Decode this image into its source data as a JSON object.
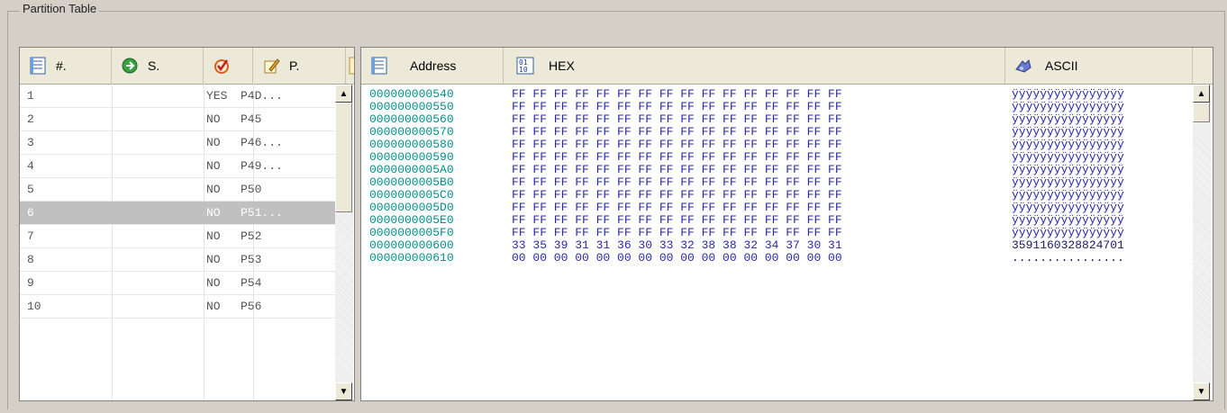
{
  "groupbox": {
    "title": "Partition Table"
  },
  "partition_table": {
    "columns": [
      {
        "label": "#.",
        "icon": "list-icon"
      },
      {
        "label": "S.",
        "icon": "green-arrow-icon"
      },
      {
        "label": "",
        "icon": "check-icon"
      },
      {
        "label": "P.",
        "icon": "pencil-icon"
      }
    ],
    "rows": [
      {
        "num": "1",
        "s": "",
        "check": "YES",
        "p": "P4D..."
      },
      {
        "num": "2",
        "s": "",
        "check": "NO",
        "p": "P45"
      },
      {
        "num": "3",
        "s": "",
        "check": "NO",
        "p": "P46..."
      },
      {
        "num": "4",
        "s": "",
        "check": "NO",
        "p": "P49..."
      },
      {
        "num": "5",
        "s": "",
        "check": "NO",
        "p": "P50"
      },
      {
        "num": "6",
        "s": "",
        "check": "NO",
        "p": "P51...",
        "selected": true
      },
      {
        "num": "7",
        "s": "",
        "check": "NO",
        "p": "P52"
      },
      {
        "num": "8",
        "s": "",
        "check": "NO",
        "p": "P53"
      },
      {
        "num": "9",
        "s": "",
        "check": "NO",
        "p": "P54"
      },
      {
        "num": "10",
        "s": "",
        "check": "NO",
        "p": "P56"
      }
    ]
  },
  "hex_view": {
    "columns": [
      {
        "label": "Address",
        "icon": "list-icon"
      },
      {
        "label": "HEX",
        "icon": "binary-icon"
      },
      {
        "label": "ASCII",
        "icon": "ascii-icon"
      }
    ],
    "rows": [
      {
        "address": "000000000540",
        "hex": "FF FF FF FF FF FF FF FF FF FF FF FF FF FF FF FF",
        "ascii": "ÿÿÿÿÿÿÿÿÿÿÿÿÿÿÿÿ"
      },
      {
        "address": "000000000550",
        "hex": "FF FF FF FF FF FF FF FF FF FF FF FF FF FF FF FF",
        "ascii": "ÿÿÿÿÿÿÿÿÿÿÿÿÿÿÿÿ"
      },
      {
        "address": "000000000560",
        "hex": "FF FF FF FF FF FF FF FF FF FF FF FF FF FF FF FF",
        "ascii": "ÿÿÿÿÿÿÿÿÿÿÿÿÿÿÿÿ"
      },
      {
        "address": "000000000570",
        "hex": "FF FF FF FF FF FF FF FF FF FF FF FF FF FF FF FF",
        "ascii": "ÿÿÿÿÿÿÿÿÿÿÿÿÿÿÿÿ"
      },
      {
        "address": "000000000580",
        "hex": "FF FF FF FF FF FF FF FF FF FF FF FF FF FF FF FF",
        "ascii": "ÿÿÿÿÿÿÿÿÿÿÿÿÿÿÿÿ"
      },
      {
        "address": "000000000590",
        "hex": "FF FF FF FF FF FF FF FF FF FF FF FF FF FF FF FF",
        "ascii": "ÿÿÿÿÿÿÿÿÿÿÿÿÿÿÿÿ"
      },
      {
        "address": "0000000005A0",
        "hex": "FF FF FF FF FF FF FF FF FF FF FF FF FF FF FF FF",
        "ascii": "ÿÿÿÿÿÿÿÿÿÿÿÿÿÿÿÿ"
      },
      {
        "address": "0000000005B0",
        "hex": "FF FF FF FF FF FF FF FF FF FF FF FF FF FF FF FF",
        "ascii": "ÿÿÿÿÿÿÿÿÿÿÿÿÿÿÿÿ"
      },
      {
        "address": "0000000005C0",
        "hex": "FF FF FF FF FF FF FF FF FF FF FF FF FF FF FF FF",
        "ascii": "ÿÿÿÿÿÿÿÿÿÿÿÿÿÿÿÿ"
      },
      {
        "address": "0000000005D0",
        "hex": "FF FF FF FF FF FF FF FF FF FF FF FF FF FF FF FF",
        "ascii": "ÿÿÿÿÿÿÿÿÿÿÿÿÿÿÿÿ"
      },
      {
        "address": "0000000005E0",
        "hex": "FF FF FF FF FF FF FF FF FF FF FF FF FF FF FF FF",
        "ascii": "ÿÿÿÿÿÿÿÿÿÿÿÿÿÿÿÿ"
      },
      {
        "address": "0000000005F0",
        "hex": "FF FF FF FF FF FF FF FF FF FF FF FF FF FF FF FF",
        "ascii": "ÿÿÿÿÿÿÿÿÿÿÿÿÿÿÿÿ"
      },
      {
        "address": "000000000600",
        "hex": "33 35 39 31 31 36 30 33 32 38 38 32 34 37 30 31",
        "ascii": "3591160328824701"
      },
      {
        "address": "000000000610",
        "hex": "00 00 00 00 00 00 00 00 00 00 00 00 00 00 00 00",
        "ascii": "................"
      }
    ]
  },
  "colors": {
    "address": "#00908a",
    "hex": "#2a2aa8",
    "selected_row": "#c0c0c0",
    "header": "#ece9d8"
  }
}
